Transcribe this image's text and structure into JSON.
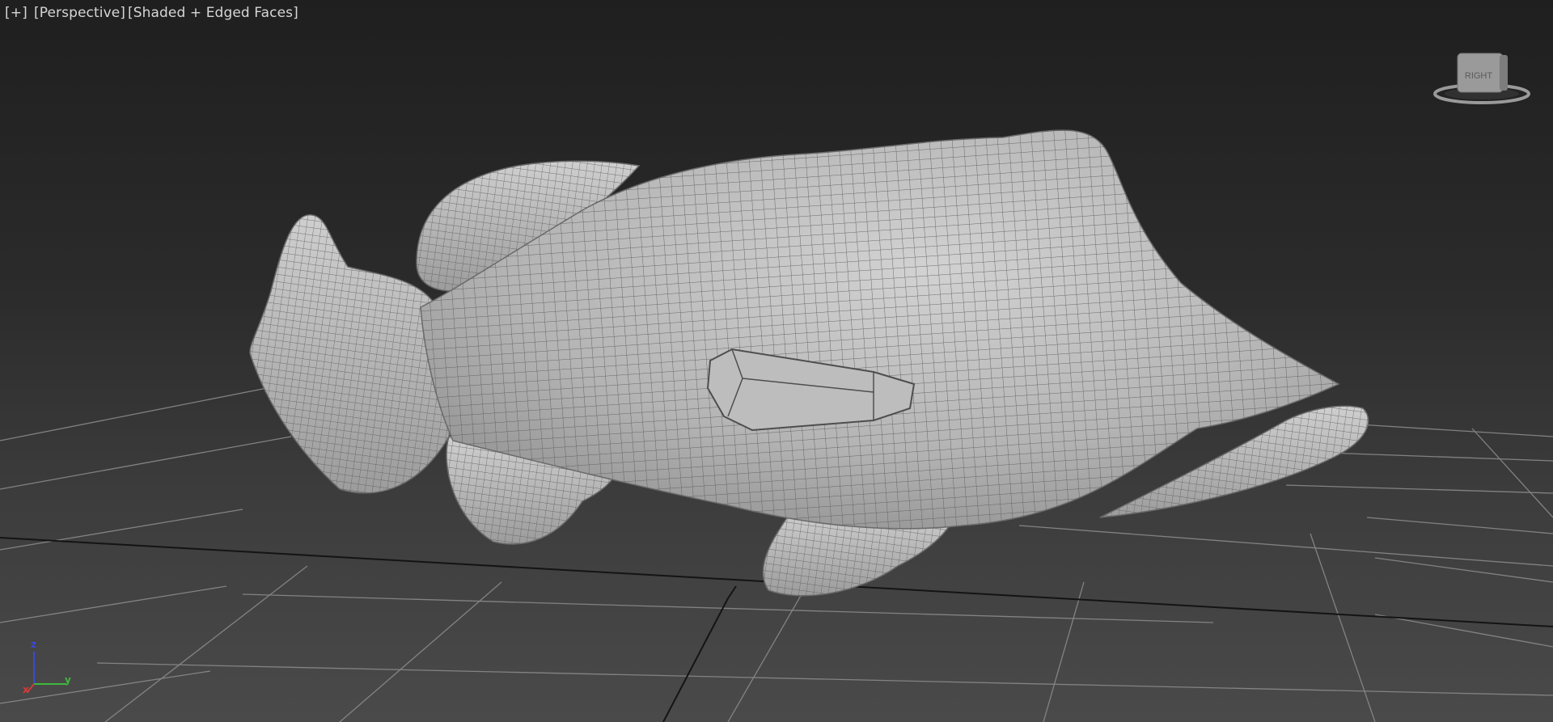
{
  "viewport": {
    "labels": {
      "plus": "[+]",
      "view": "[Perspective]",
      "shading": "[Shaded + Edged Faces]"
    }
  },
  "viewcube": {
    "face_label": "RIGHT",
    "icon": "viewcube-icon"
  },
  "axis_tripod": {
    "z": "z",
    "y": "y",
    "x": "x",
    "colors": {
      "x": "#d43a3a",
      "y": "#3cba3c",
      "z": "#3a4ad6"
    }
  },
  "scene": {
    "object": "fish-mesh",
    "mesh_color": "#b8b8b8",
    "wire_color": "#5e5e5e",
    "grid_color": "#8a8a8a"
  }
}
